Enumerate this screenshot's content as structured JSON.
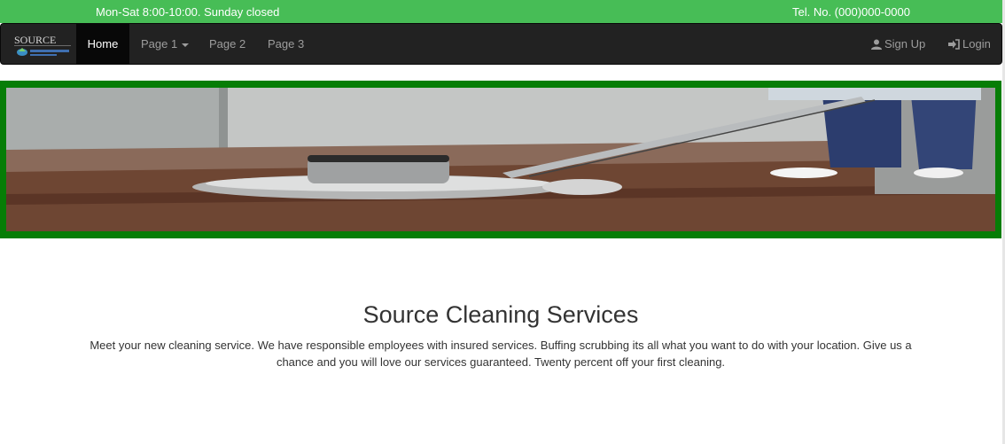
{
  "topbar": {
    "hours": "Mon-Sat 8:00-10:00. Sunday closed",
    "phone": "Tel. No. (000)000-0000"
  },
  "brand": {
    "text": "SOURCE",
    "icon": "source-logo"
  },
  "nav": {
    "items": [
      {
        "label": "Home",
        "active": true
      },
      {
        "label": "Page 1",
        "dropdown": true
      },
      {
        "label": "Page 2"
      },
      {
        "label": "Page 3"
      }
    ],
    "right": [
      {
        "label": "Sign Up",
        "icon": "user-icon"
      },
      {
        "label": "Login",
        "icon": "login-icon"
      }
    ]
  },
  "hero": {
    "image": "floor-buffer-machine-cleaning-wood-floor"
  },
  "main": {
    "title": "Source Cleaning Services",
    "description": "Meet your new cleaning service. We have responsible employees with insured services. Buffing scrubbing its all what you want to do with your location. Give us a chance and you will love our services guaranteed. Twenty percent off your first cleaning."
  },
  "colors": {
    "topbar": "#47bd56",
    "navbar": "#222222",
    "hero_border": "#067d06"
  }
}
